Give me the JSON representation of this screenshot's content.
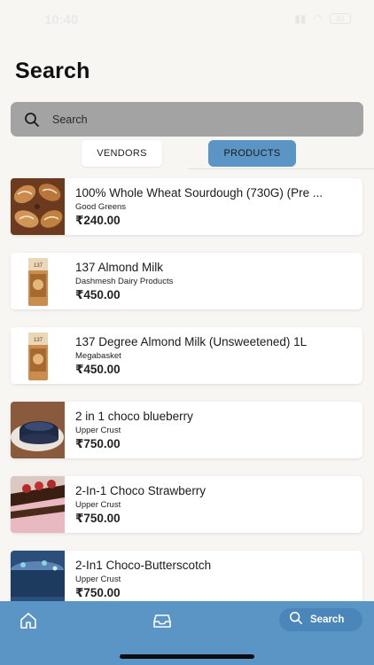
{
  "status_bar": {
    "time": "10:40",
    "battery": "83"
  },
  "page": {
    "title": "Search"
  },
  "search": {
    "placeholder": "Search"
  },
  "tabs": [
    {
      "label": "VENDORS",
      "active": false
    },
    {
      "label": "PRODUCTS",
      "active": true
    }
  ],
  "products": [
    {
      "name": "100% Whole Wheat Sourdough (730G) (Pre ...",
      "vendor": "Good Greens",
      "price": "₹240.00",
      "thumb_icon": "bread-image"
    },
    {
      "name": "137 Almond Milk",
      "vendor": "Dashmesh Dairy Products",
      "price": "₹450.00",
      "thumb_icon": "milk-carton-image"
    },
    {
      "name": "137 Degree Almond Milk (Unsweetened) 1L",
      "vendor": "Megabasket",
      "price": "₹450.00",
      "thumb_icon": "milk-carton-image"
    },
    {
      "name": "2 in 1 choco blueberry",
      "vendor": "Upper Crust",
      "price": "₹750.00",
      "thumb_icon": "cake-image"
    },
    {
      "name": "2-In-1 Choco Strawberry",
      "vendor": "Upper Crust",
      "price": "₹750.00",
      "thumb_icon": "cake-image"
    },
    {
      "name": "2-In1 Choco-Butterscotch",
      "vendor": "Upper Crust",
      "price": "₹750.00",
      "thumb_icon": "cake-image"
    }
  ],
  "bottom_nav": {
    "search_label": "Search"
  },
  "colors": {
    "accent": "#5b95c5",
    "background": "#f7f6f3",
    "search_bar": "#a3a3a3"
  }
}
